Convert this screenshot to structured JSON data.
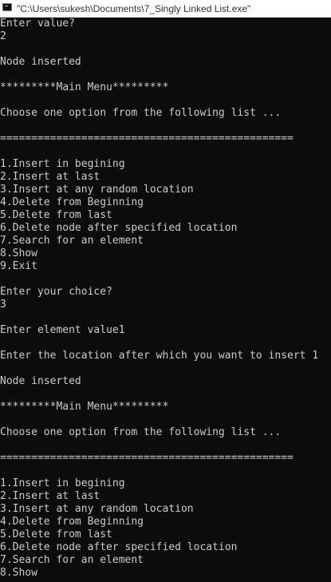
{
  "window": {
    "title": "\"C:\\Users\\sukesh\\Documents\\7_Singly Linked List.exe\"",
    "icon": "console-app-icon"
  },
  "console": {
    "lines": [
      "Enter value?",
      "2",
      "",
      "Node inserted",
      "",
      "*********Main Menu*********",
      "",
      "Choose one option from the following list ...",
      "",
      "===============================================",
      "",
      "1.Insert in begining",
      "2.Insert at last",
      "3.Insert at any random location",
      "4.Delete from Beginning",
      "5.Delete from last",
      "6.Delete node after specified location",
      "7.Search for an element",
      "8.Show",
      "9.Exit",
      "",
      "Enter your choice?",
      "3",
      "",
      "Enter element value1",
      "",
      "Enter the location after which you want to insert 1",
      "",
      "Node inserted",
      "",
      "*********Main Menu*********",
      "",
      "Choose one option from the following list ...",
      "",
      "===============================================",
      "",
      "1.Insert in begining",
      "2.Insert at last",
      "3.Insert at any random location",
      "4.Delete from Beginning",
      "5.Delete from last",
      "6.Delete node after specified location",
      "7.Search for an element",
      "8.Show"
    ]
  }
}
